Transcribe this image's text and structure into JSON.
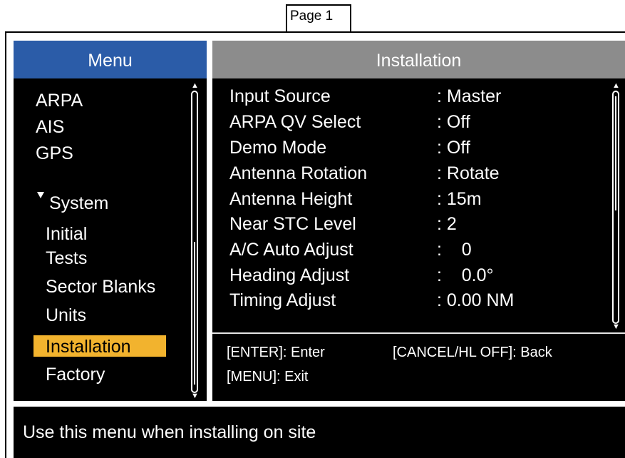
{
  "page_tab": "Page 1",
  "menu": {
    "title": "Menu",
    "items": [
      {
        "label": "ARPA"
      },
      {
        "label": "AIS"
      },
      {
        "label": "GPS"
      }
    ],
    "system_label": "System",
    "sub_items": [
      {
        "label": "Initial"
      },
      {
        "label": "Tests"
      },
      {
        "label": "Sector Blanks"
      },
      {
        "label": "Units"
      },
      {
        "label": "Installation"
      },
      {
        "label": "Factory"
      }
    ],
    "selected": "Installation"
  },
  "installation": {
    "title": "Installation",
    "rows": [
      {
        "label": "Input Source",
        "value": ": Master"
      },
      {
        "label": "ARPA QV Select",
        "value": ": Off"
      },
      {
        "label": "Demo Mode",
        "value": ": Off"
      },
      {
        "label": "Antenna Rotation",
        "value": ": Rotate"
      },
      {
        "label": "Antenna Height",
        "value": ": 15m"
      },
      {
        "label": "Near STC Level",
        "value": ": 2"
      },
      {
        "label": "A/C Auto Adjust",
        "value": ":    0"
      },
      {
        "label": "Heading Adjust",
        "value": ":    0.0°"
      },
      {
        "label": "Timing Adjust",
        "value": ": 0.00 NM"
      }
    ],
    "hints": {
      "enter": "[ENTER]: Enter",
      "cancel": "[CANCEL/HL OFF]: Back",
      "menu": "[MENU]: Exit"
    }
  },
  "status": {
    "text": "Use this menu when installing on site"
  },
  "colors": {
    "menu_header": "#2b5ca8",
    "installation_header": "#8c8c8c",
    "selection_highlight": "#f2b32e",
    "panel_background": "#000000"
  },
  "icons": {
    "expand": "triangle-down-icon",
    "scroll_up": "arrow-up-icon",
    "scroll_down": "arrow-down-icon"
  }
}
